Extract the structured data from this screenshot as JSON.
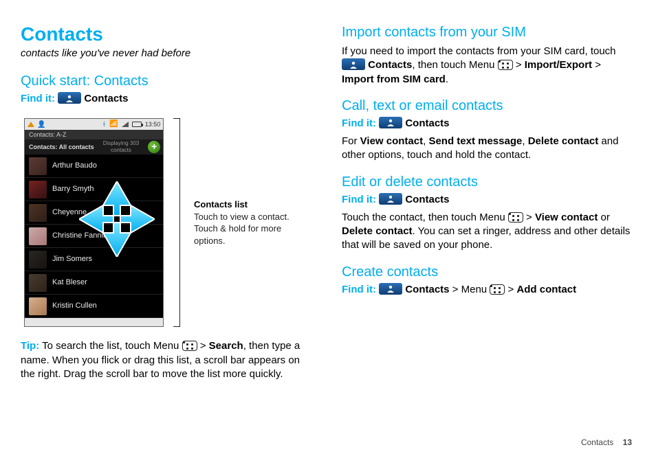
{
  "left": {
    "title": "Contacts",
    "tagline": "contacts like you've never had before",
    "quickstart_h": "Quick start: Contacts",
    "findit_label": "Find it:",
    "contacts_label": "Contacts",
    "phone": {
      "time": "13:50",
      "alpha": "Contacts: A-Z",
      "filter": "Contacts: All contacts",
      "count": "Displaying 303 contacts",
      "plus": "+",
      "rows": [
        {
          "name": "Arthur Baudo"
        },
        {
          "name": "Barry Smyth"
        },
        {
          "name": "Cheyenne"
        },
        {
          "name": "Christine Fanning"
        },
        {
          "name": "Jim Somers"
        },
        {
          "name": "Kat Bleser"
        },
        {
          "name": "Kristin Cullen"
        }
      ]
    },
    "callout_title": "Contacts list",
    "callout_body": "Touch to view a contact. Touch & hold for more options.",
    "tip_label": "Tip:",
    "tip_t1": " To search the list, touch Menu ",
    "tip_t2": " > ",
    "tip_search": "Search",
    "tip_t3": ", then type a name. When you flick or drag this list, a scroll bar appears on the right. Drag the scroll bar to move the list more quickly."
  },
  "right": {
    "import_h": "Import contacts from your SIM",
    "import_p1a": "If you need to import the contacts from your SIM card, touch ",
    "import_p1b": "Contacts",
    "import_p1c": ", then touch Menu ",
    "import_p1d": " > ",
    "import_bold1": "Import/Export",
    "import_gt": " > ",
    "import_bold2": "Import from SIM card",
    "import_dot": ".",
    "cte_h": "Call, text or email contacts",
    "findit_label": "Find it:",
    "contacts_label": "Contacts",
    "cte_p_a": "For ",
    "cte_view": "View contact",
    "cte_c1": ", ",
    "cte_send": "Send text message",
    "cte_c2": ", ",
    "cte_del": "Delete contact",
    "cte_rest": " and other options, touch and hold the contact.",
    "edit_h": "Edit or delete contacts",
    "edit_p_a": "Touch the contact, then touch Menu ",
    "edit_gt1": " > ",
    "edit_view": "View contact",
    "edit_or": " or ",
    "edit_del": "Delete contact",
    "edit_rest": ". You can set a ringer, address and other details that will be saved on your phone.",
    "create_h": "Create contacts",
    "create_findit_a": "Contacts",
    "create_findit_b": " > Menu ",
    "create_findit_c": " > ",
    "create_add": "Add contact"
  },
  "footer": {
    "section": "Contacts",
    "page": "13"
  }
}
